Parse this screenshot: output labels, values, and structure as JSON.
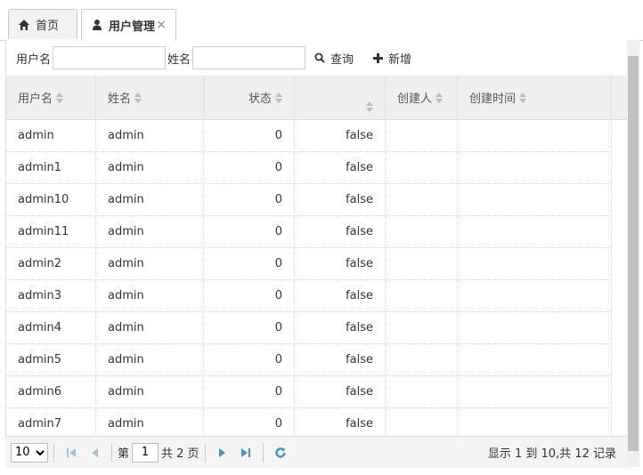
{
  "tabs": [
    {
      "label": "首页",
      "icon": "home-icon"
    },
    {
      "label": "用户管理",
      "icon": "user-icon",
      "close": "×"
    }
  ],
  "toolbar": {
    "username_label": "用户名",
    "username_value": "",
    "name_label": "姓名",
    "name_value": "",
    "search_label": "查询",
    "add_label": "新增"
  },
  "columns": [
    "用户名",
    "姓名",
    "状态",
    "",
    "创建人",
    "创建时间"
  ],
  "rows": [
    {
      "username": "admin",
      "name": "admin",
      "status": "0",
      "flag": "false",
      "creator": "",
      "created": ""
    },
    {
      "username": "admin1",
      "name": "admin",
      "status": "0",
      "flag": "false",
      "creator": "",
      "created": ""
    },
    {
      "username": "admin10",
      "name": "admin",
      "status": "0",
      "flag": "false",
      "creator": "",
      "created": ""
    },
    {
      "username": "admin11",
      "name": "admin",
      "status": "0",
      "flag": "false",
      "creator": "",
      "created": ""
    },
    {
      "username": "admin2",
      "name": "admin",
      "status": "0",
      "flag": "false",
      "creator": "",
      "created": ""
    },
    {
      "username": "admin3",
      "name": "admin",
      "status": "0",
      "flag": "false",
      "creator": "",
      "created": ""
    },
    {
      "username": "admin4",
      "name": "admin",
      "status": "0",
      "flag": "false",
      "creator": "",
      "created": ""
    },
    {
      "username": "admin5",
      "name": "admin",
      "status": "0",
      "flag": "false",
      "creator": "",
      "created": ""
    },
    {
      "username": "admin6",
      "name": "admin",
      "status": "0",
      "flag": "false",
      "creator": "",
      "created": ""
    },
    {
      "username": "admin7",
      "name": "admin",
      "status": "0",
      "flag": "false",
      "creator": "",
      "created": ""
    }
  ],
  "pager": {
    "page_size": "10",
    "page_label_pre": "第",
    "page_value": "1",
    "page_label_post": "共 2 页",
    "info": "显示 1 到 10,共 12 记录"
  },
  "colors": {
    "pager_icon": "#4a90c8",
    "header_bg": "#efefef",
    "scroll_thumb": "#c1c1c1"
  }
}
